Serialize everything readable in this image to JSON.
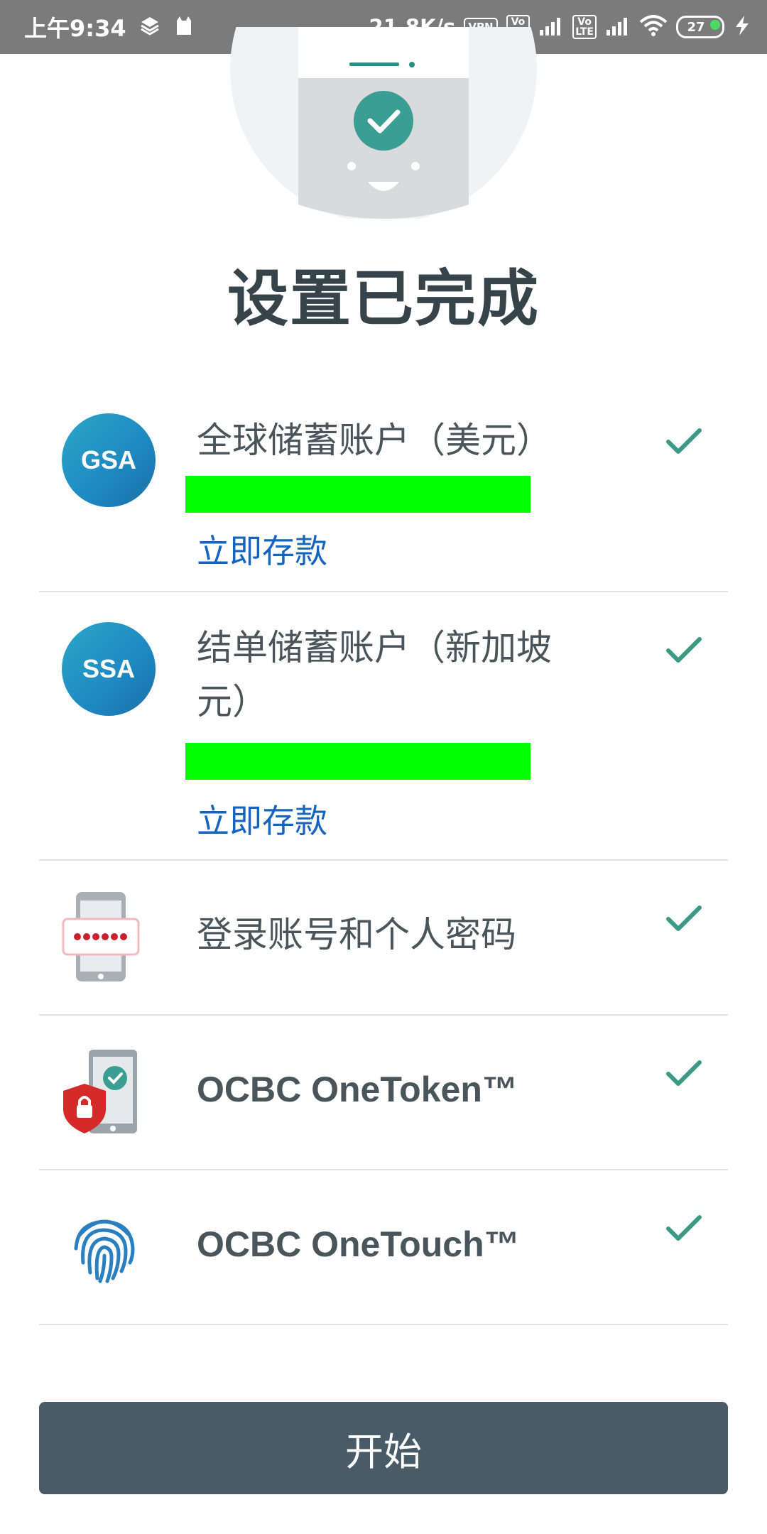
{
  "status_bar": {
    "time": "上午9:34",
    "speed": "21.8K/s",
    "vpn": "VPN",
    "volte1": "Vo LTE",
    "volte2": "Vo LTE",
    "battery": "27"
  },
  "page": {
    "title": "设置已完成"
  },
  "items": [
    {
      "badge": "GSA",
      "label": "全球储蓄账户（美元）",
      "action": "立即存款"
    },
    {
      "badge": "SSA",
      "label_line1": "结单储蓄账户（新加坡",
      "label_line2": "元）",
      "action": "立即存款"
    },
    {
      "label": "登录账号和个人密码"
    },
    {
      "label": "OCBC OneToken™"
    },
    {
      "label": "OCBC OneTouch™"
    }
  ],
  "start_button": {
    "label": "开始"
  },
  "colors": {
    "check": "#3a9a86",
    "link": "#1565c0",
    "button": "#485b66",
    "redaction": "#00ff00"
  }
}
